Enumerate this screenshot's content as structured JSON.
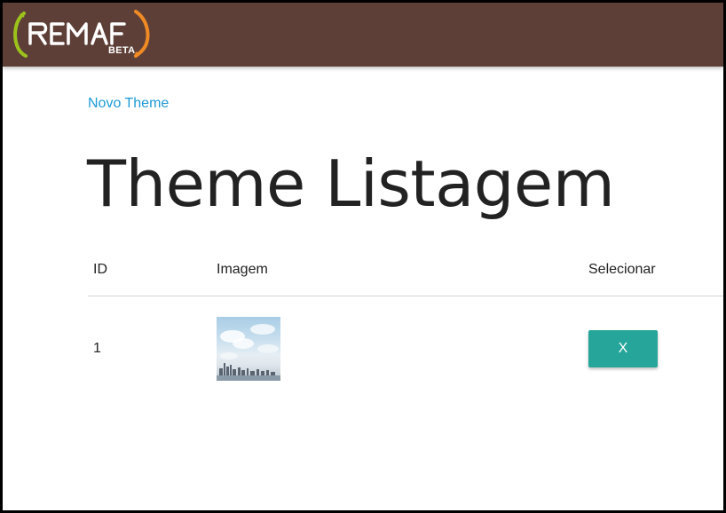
{
  "brand": {
    "name": "REMAF",
    "tag": "BETA"
  },
  "actions": {
    "new_link": "Novo Theme"
  },
  "page": {
    "title": "Theme Listagem"
  },
  "table": {
    "headers": [
      "ID",
      "Imagem",
      "Selecionar"
    ],
    "rows": [
      {
        "id": "1",
        "image_icon": "city-skyline-thumbnail",
        "select_label": "X"
      }
    ]
  },
  "colors": {
    "topbar": "#5e3f37",
    "link": "#1e9ad6",
    "button": "#26a69a"
  }
}
